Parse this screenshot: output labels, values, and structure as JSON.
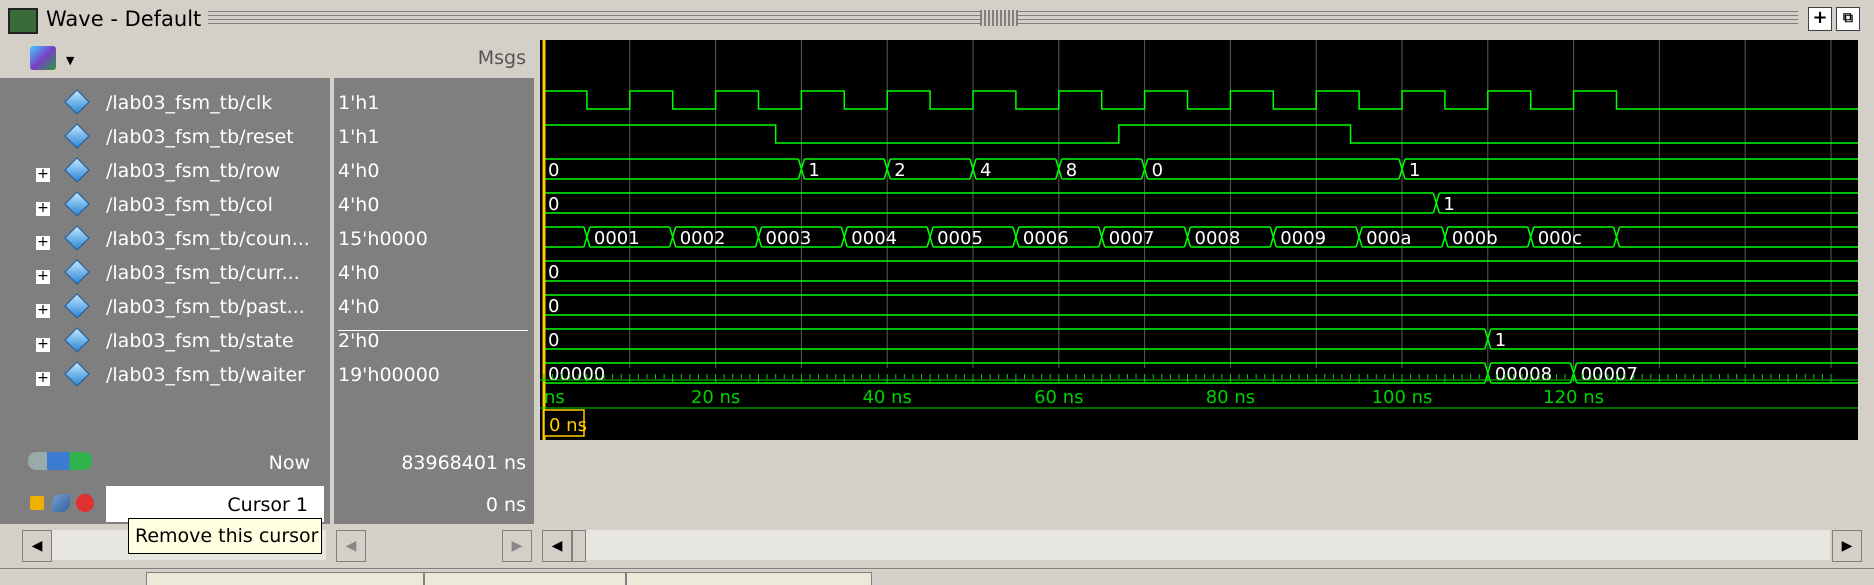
{
  "window": {
    "title": "Wave - Default"
  },
  "toolbar": {
    "plus_button": "+",
    "undock_button": "⧉"
  },
  "name_pane": {
    "header_icon": "signal-palette-icon"
  },
  "value_pane": {
    "header": "Msgs"
  },
  "signals": [
    {
      "name": "/lab03_fsm_tb/clk",
      "value": "1'h1",
      "expandable": false
    },
    {
      "name": "/lab03_fsm_tb/reset",
      "value": "1'h1",
      "expandable": false
    },
    {
      "name": "/lab03_fsm_tb/row",
      "value": "4'h0",
      "expandable": true
    },
    {
      "name": "/lab03_fsm_tb/col",
      "value": "4'h0",
      "expandable": true
    },
    {
      "name": "/lab03_fsm_tb/coun...",
      "value": "15'h0000",
      "expandable": true
    },
    {
      "name": "/lab03_fsm_tb/curr...",
      "value": "4'h0",
      "expandable": true
    },
    {
      "name": "/lab03_fsm_tb/past...",
      "value": "4'h0",
      "expandable": true
    },
    {
      "name": "/lab03_fsm_tb/state",
      "value": "2'h0",
      "expandable": true
    },
    {
      "name": "/lab03_fsm_tb/waiter",
      "value": "19'h00000",
      "expandable": true
    }
  ],
  "bus_segments": {
    "row": [
      {
        "t": 0,
        "v": "0"
      },
      {
        "t": 30,
        "v": "1"
      },
      {
        "t": 40,
        "v": "2"
      },
      {
        "t": 50,
        "v": "4"
      },
      {
        "t": 60,
        "v": "8"
      },
      {
        "t": 70,
        "v": "0"
      },
      {
        "t": 100,
        "v": "1"
      }
    ],
    "col": [
      {
        "t": 0,
        "v": "0"
      },
      {
        "t": 104,
        "v": "1"
      }
    ],
    "coun": [
      {
        "t": 0,
        "v": ""
      },
      {
        "t": 5,
        "v": "0001"
      },
      {
        "t": 15,
        "v": "0002"
      },
      {
        "t": 25,
        "v": "0003"
      },
      {
        "t": 35,
        "v": "0004"
      },
      {
        "t": 45,
        "v": "0005"
      },
      {
        "t": 55,
        "v": "0006"
      },
      {
        "t": 65,
        "v": "0007"
      },
      {
        "t": 75,
        "v": "0008"
      },
      {
        "t": 85,
        "v": "0009"
      },
      {
        "t": 95,
        "v": "000a"
      },
      {
        "t": 105,
        "v": "000b"
      },
      {
        "t": 115,
        "v": "000c"
      },
      {
        "t": 125,
        "v": ""
      }
    ],
    "curr": [
      {
        "t": 0,
        "v": "0"
      }
    ],
    "past": [
      {
        "t": 0,
        "v": "0"
      }
    ],
    "state": [
      {
        "t": 0,
        "v": "0"
      },
      {
        "t": 110,
        "v": "1"
      }
    ],
    "waiter": [
      {
        "t": 0,
        "v": "00000"
      },
      {
        "t": 110,
        "v": "00008"
      },
      {
        "t": 120,
        "v": "00007"
      }
    ]
  },
  "clk_edges": [
    5,
    10,
    15,
    20,
    25,
    30,
    35,
    40,
    45,
    50,
    55,
    60,
    65,
    70,
    75,
    80,
    85,
    90,
    95,
    100,
    105,
    110,
    115,
    120,
    125
  ],
  "reset_edges": [
    {
      "t": 27,
      "level": 0
    },
    {
      "t": 67,
      "level": 1
    },
    {
      "t": 94,
      "level": 0
    }
  ],
  "timeline": {
    "now_label": "Now",
    "now_value": "83968401 ns",
    "cursor_label": "Cursor 1",
    "cursor_value": "0 ns",
    "cursor_marker": "0 ns",
    "ticks": [
      {
        "t": 0,
        "label": "ns"
      },
      {
        "t": 20,
        "label": "20 ns"
      },
      {
        "t": 40,
        "label": "40 ns"
      },
      {
        "t": 60,
        "label": "60 ns"
      },
      {
        "t": 80,
        "label": "80 ns"
      },
      {
        "t": 100,
        "label": "100 ns"
      },
      {
        "t": 120,
        "label": "120 ns"
      }
    ]
  },
  "tooltip": "Remove this cursor",
  "colors": {
    "wave": "#00ff00",
    "text": "#ffffff",
    "cursor": "#ffcc00",
    "grid": "#5a5a5a",
    "bg": "#000000"
  }
}
